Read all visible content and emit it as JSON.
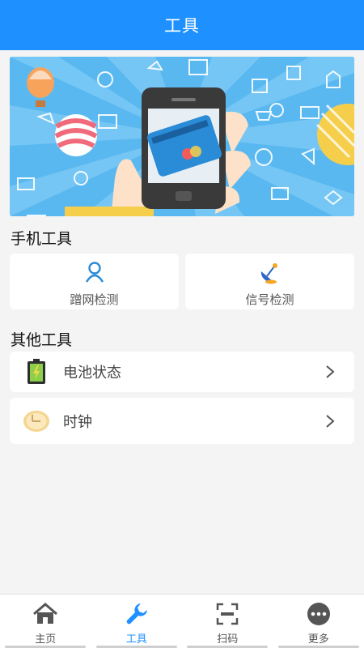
{
  "header": {
    "title": "工具"
  },
  "sections": {
    "phone_tools": "手机工具",
    "other_tools": "其他工具"
  },
  "phone_tools": [
    {
      "label": "蹭网检测",
      "icon": "user-outline-icon"
    },
    {
      "label": "信号检测",
      "icon": "satellite-dish-icon"
    }
  ],
  "other_tools": [
    {
      "label": "电池状态",
      "icon": "battery-charging-icon"
    },
    {
      "label": "时钟",
      "icon": "clock-icon"
    }
  ],
  "tabbar": {
    "items": [
      {
        "label": "主页",
        "icon": "home-icon",
        "active": false
      },
      {
        "label": "工具",
        "icon": "wrench-icon",
        "active": true
      },
      {
        "label": "扫码",
        "icon": "scan-icon",
        "active": false
      },
      {
        "label": "更多",
        "icon": "more-icon",
        "active": false
      }
    ]
  },
  "colors": {
    "primary": "#1e90ff",
    "background": "#f4f4f4",
    "card": "#ffffff",
    "banner_sky": "#5ab8f0"
  }
}
